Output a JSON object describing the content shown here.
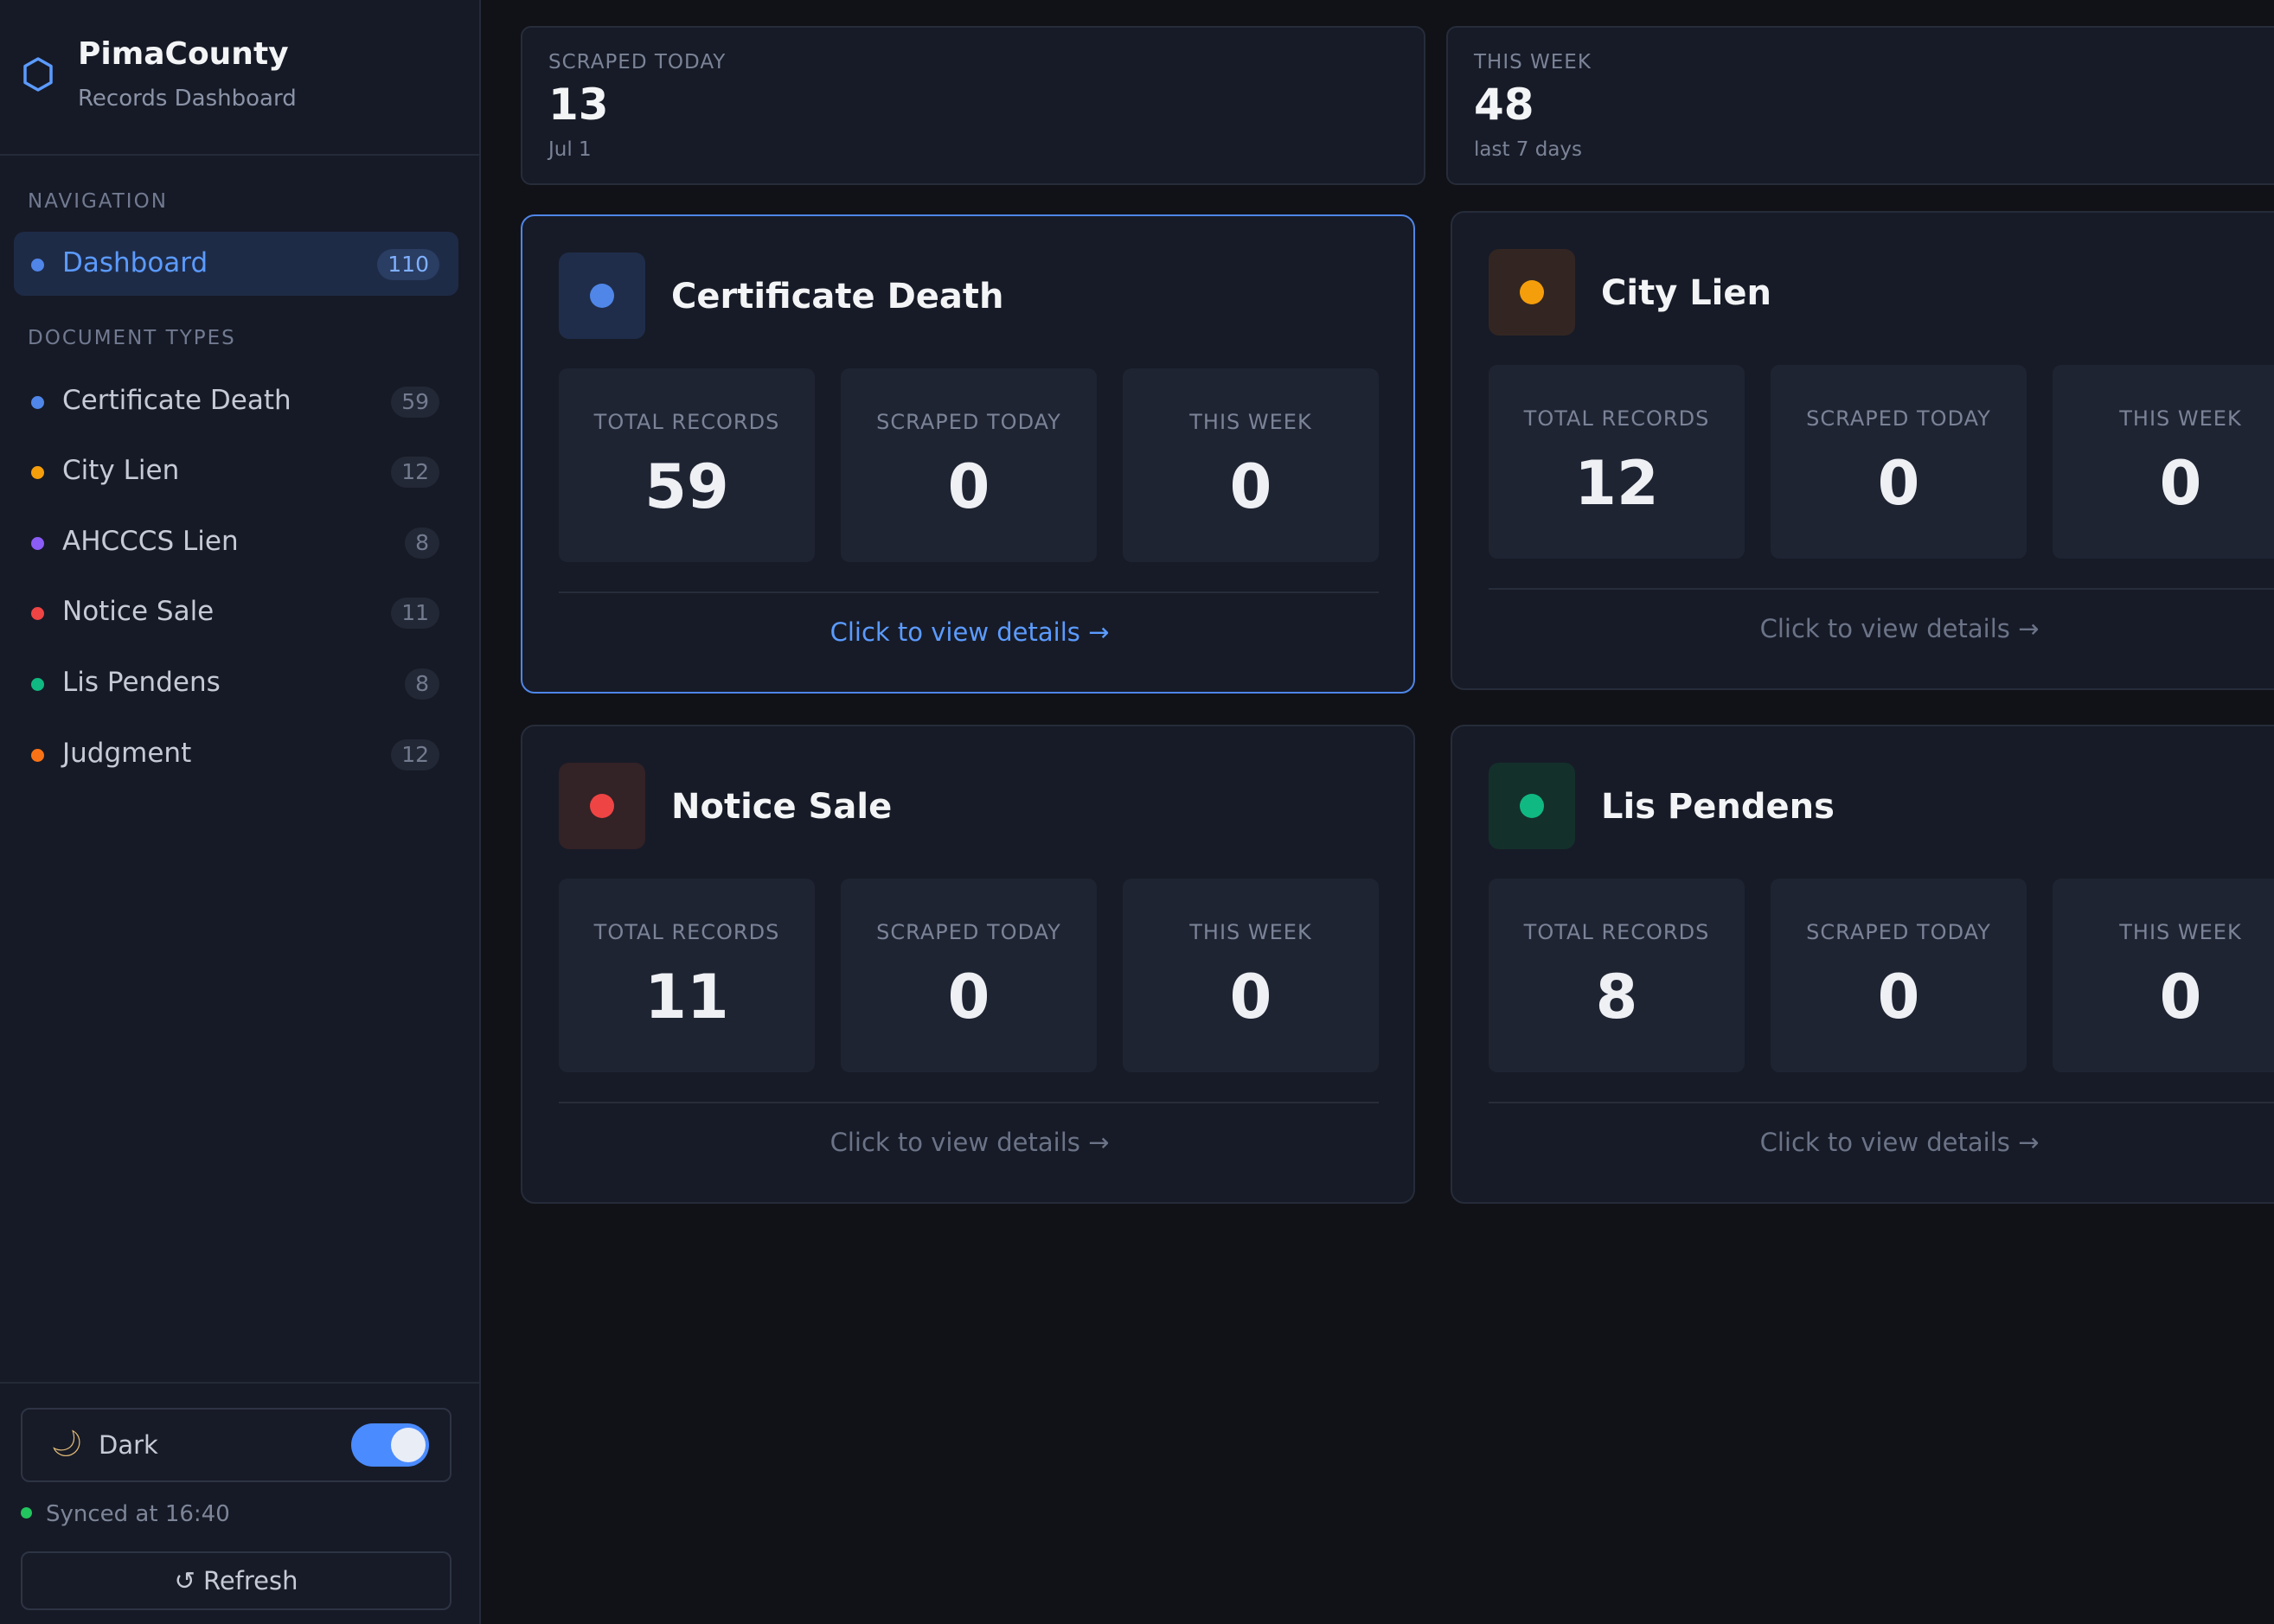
{
  "brand": {
    "name": "PimaCounty",
    "subtitle": "Records Dashboard",
    "icon": "hexagon-icon",
    "accent": "#5b9bff"
  },
  "nav": {
    "label": "NAVIGATION",
    "dashboard": {
      "label": "Dashboard",
      "count": "110",
      "color": "#4f86e8"
    }
  },
  "doc_types": {
    "label": "DOCUMENT TYPES",
    "items": [
      {
        "label": "Certificate Death",
        "count": "59",
        "color": "#4f86e8"
      },
      {
        "label": "City Lien",
        "count": "12",
        "color": "#f59e0b"
      },
      {
        "label": "AHCCCS Lien",
        "count": "8",
        "color": "#8b5cf6"
      },
      {
        "label": "Notice Sale",
        "count": "11",
        "color": "#ef4444"
      },
      {
        "label": "Lis Pendens",
        "count": "8",
        "color": "#10b981"
      },
      {
        "label": "Judgment",
        "count": "12",
        "color": "#f97316"
      }
    ]
  },
  "theme": {
    "label": "Dark",
    "icon": "moon-icon",
    "enabled": true
  },
  "sync": {
    "text": "Synced at 16:40",
    "color": "#22c55e"
  },
  "refresh": {
    "label": "↺ Refresh"
  },
  "summary": [
    {
      "label": "SCRAPED TODAY",
      "value": "13",
      "sub": "Jul 1"
    },
    {
      "label": "THIS WEEK",
      "value": "48",
      "sub": "last 7 days"
    }
  ],
  "cards": [
    {
      "title": "Certificate Death",
      "color": "#4f86e8",
      "icon_bg": "#1f2d4a",
      "selected": true,
      "metrics": [
        {
          "label": "TOTAL RECORDS",
          "value": "59"
        },
        {
          "label": "SCRAPED TODAY",
          "value": "0"
        },
        {
          "label": "THIS WEEK",
          "value": "0"
        }
      ],
      "link": "Click to view details →"
    },
    {
      "title": "City Lien",
      "color": "#f59e0b",
      "icon_bg": "#332622",
      "selected": false,
      "metrics": [
        {
          "label": "TOTAL RECORDS",
          "value": "12"
        },
        {
          "label": "SCRAPED TODAY",
          "value": "0"
        },
        {
          "label": "THIS WEEK",
          "value": "0"
        }
      ],
      "link": "Click to view details →"
    },
    {
      "title": "Notice Sale",
      "color": "#ef4444",
      "icon_bg": "#332226",
      "selected": false,
      "metrics": [
        {
          "label": "TOTAL RECORDS",
          "value": "11"
        },
        {
          "label": "SCRAPED TODAY",
          "value": "0"
        },
        {
          "label": "THIS WEEK",
          "value": "0"
        }
      ],
      "link": "Click to view details →"
    },
    {
      "title": "Lis Pendens",
      "color": "#10b981",
      "icon_bg": "#14302b",
      "selected": false,
      "metrics": [
        {
          "label": "TOTAL RECORDS",
          "value": "8"
        },
        {
          "label": "SCRAPED TODAY",
          "value": "0"
        },
        {
          "label": "THIS WEEK",
          "value": "0"
        }
      ],
      "link": "Click to view details →"
    }
  ]
}
